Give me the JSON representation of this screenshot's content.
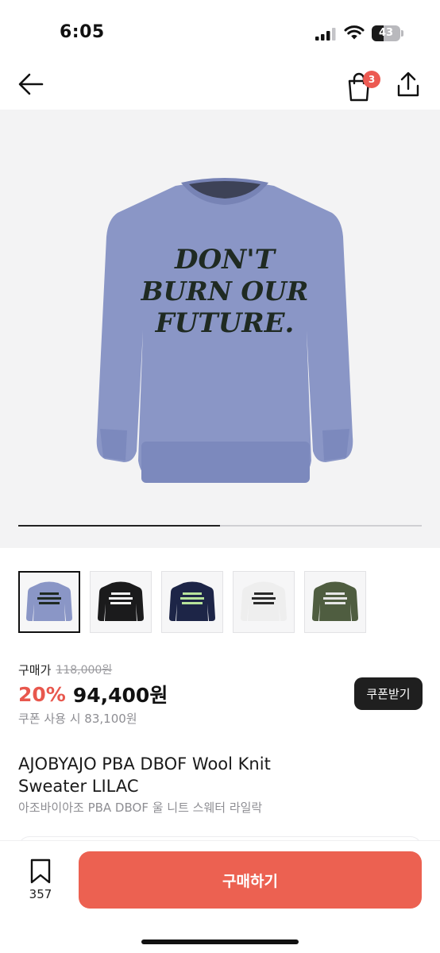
{
  "status_bar": {
    "time": "6:05",
    "battery_level": "43",
    "battery_fraction": 0.43,
    "icons": [
      "cellular-signal-icon",
      "wifi-icon",
      "battery-icon"
    ]
  },
  "nav": {
    "back_icon": "arrow-left-icon",
    "cart_icon": "shopping-bag-icon",
    "cart_badge": "3",
    "share_icon": "share-icon"
  },
  "gallery": {
    "progress": 0.5,
    "main_image": {
      "color": "#8a96c6",
      "graphic_text": [
        "DON'T",
        "BURN OUR",
        "FUTURE."
      ]
    },
    "thumbnails": [
      {
        "color": "#8a96c6",
        "text": "#1f2a22",
        "selected": true
      },
      {
        "color": "#1b1b1c",
        "text": "#f2f2f2",
        "selected": false
      },
      {
        "color": "#1d2547",
        "text": "#b7e39b",
        "selected": false
      },
      {
        "color": "#eeeeee",
        "text": "#2a2a2a",
        "selected": false
      },
      {
        "color": "#4f5d40",
        "text": "#e6e6e6",
        "selected": false
      }
    ]
  },
  "price": {
    "label": "구매가",
    "original": "118,000원",
    "discount": "20%",
    "sale": "94,400원",
    "coupon_price": "쿠폰 사용 시 83,100원",
    "coupon_button": "쿠폰받기"
  },
  "product": {
    "title_line1": "AJOBYAJO PBA DBOF Wool Knit",
    "title_line2": "Sweater LILAC",
    "title_kr": "아조바이아조 PBA DBOF 울 니트 스웨터 라일락"
  },
  "bottom": {
    "wishlist_icon": "bookmark-icon",
    "wishlist_count": "357",
    "buy_label": "구매하기"
  },
  "colors": {
    "accent": "#ec6151",
    "discount": "#e8574d",
    "badge": "#ec5a52"
  }
}
